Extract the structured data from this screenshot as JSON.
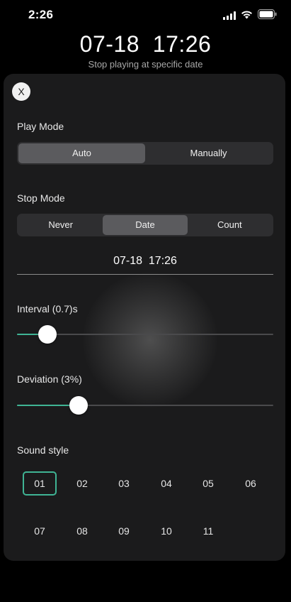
{
  "status_bar": {
    "time": "2:26",
    "icons": [
      "signal-icon",
      "wifi-icon",
      "battery-icon"
    ]
  },
  "header": {
    "time": "07-18  17:26",
    "subtitle": "Stop playing at specific date"
  },
  "sheet": {
    "close_label": "X",
    "play_mode": {
      "label": "Play Mode",
      "options": [
        "Auto",
        "Manually"
      ],
      "selected": "Auto"
    },
    "stop_mode": {
      "label": "Stop Mode",
      "options": [
        "Never",
        "Date",
        "Count"
      ],
      "selected": "Date",
      "date_value": "07-18  17:26"
    },
    "interval": {
      "label": "Interval (0.7)s",
      "value": 0.7,
      "fraction": 0.12
    },
    "deviation": {
      "label": "Deviation (3%)",
      "value": 3,
      "fraction": 0.24
    },
    "sound_style": {
      "label": "Sound style",
      "items": [
        "01",
        "02",
        "03",
        "04",
        "05",
        "06",
        "07",
        "08",
        "09",
        "10",
        "11"
      ],
      "selected": "01"
    }
  },
  "colors": {
    "accent": "#3fb494",
    "sheet_background": "#1b1b1c",
    "segment_background": "#2e2e30",
    "segment_selected": "#5b5b5e"
  }
}
